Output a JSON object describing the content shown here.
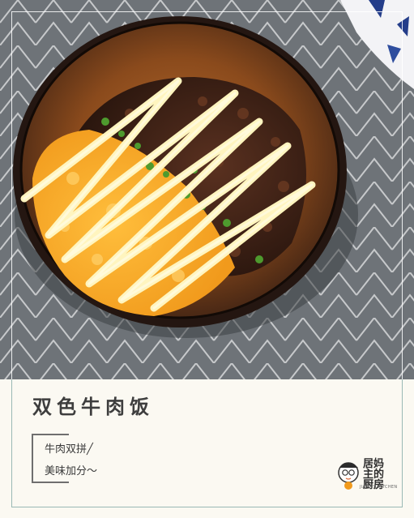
{
  "photo": {
    "alt": ""
  },
  "card": {
    "title": "双色牛肉饭",
    "tagline_line1": "牛肉双拼╱",
    "tagline_line2": "美味加分～"
  },
  "logo": {
    "name": "居妈主的厨房",
    "subtitle": "JIAMA'S KITCHEN"
  },
  "colors": {
    "tablecloth": "#6f7479",
    "egg": "#f6a623",
    "beef": "#3a1f14",
    "mayo": "#fff4b8",
    "bowl": "#2a1b14",
    "accent_border": "#9ab9b5"
  }
}
